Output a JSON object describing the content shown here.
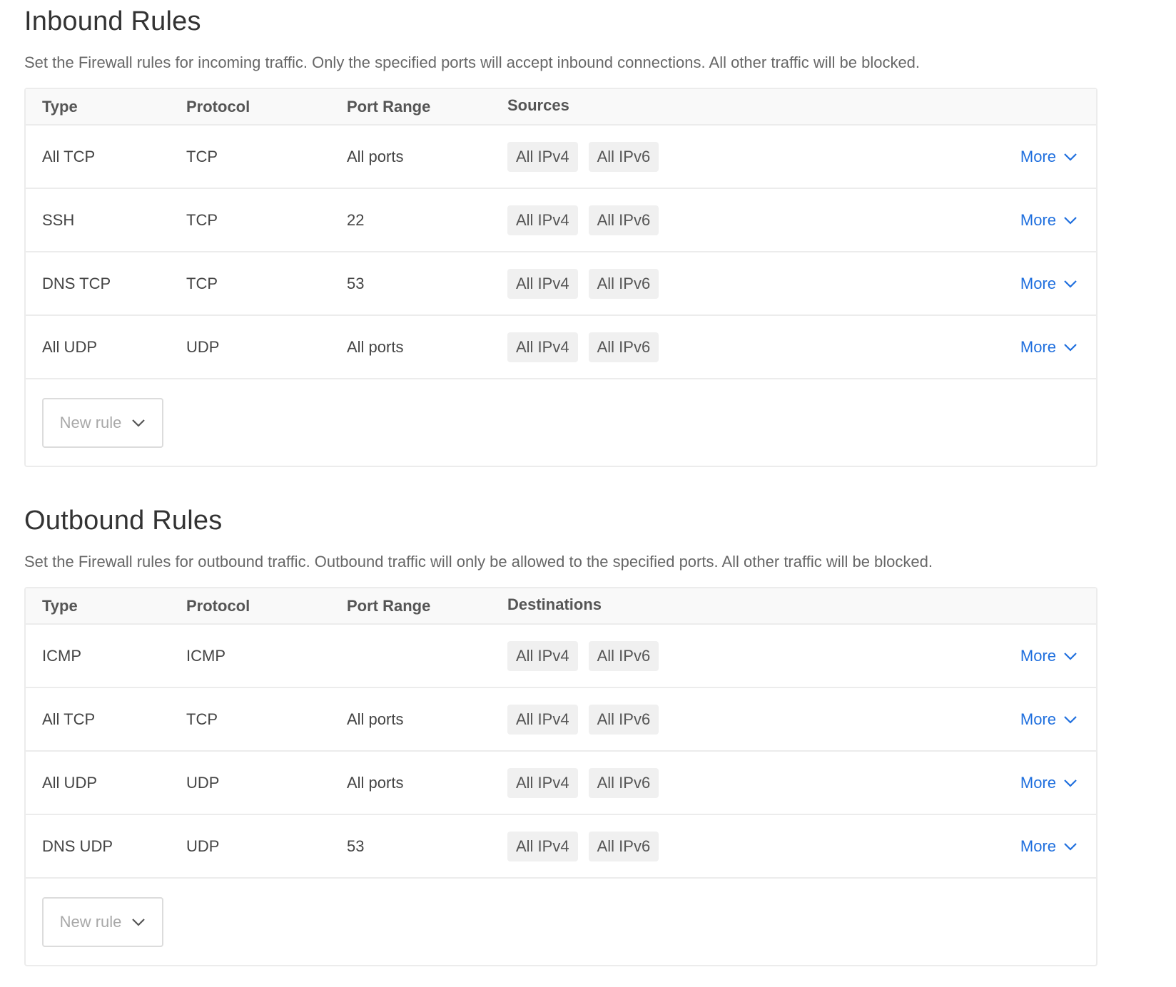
{
  "inbound": {
    "title": "Inbound Rules",
    "description": "Set the Firewall rules for incoming traffic. Only the specified ports will accept inbound connections. All other traffic will be blocked.",
    "headers": {
      "type": "Type",
      "protocol": "Protocol",
      "port_range": "Port Range",
      "targets": "Sources"
    },
    "rows": [
      {
        "type": "All TCP",
        "protocol": "TCP",
        "port_range": "All ports",
        "targets": [
          "All IPv4",
          "All IPv6"
        ],
        "more": "More"
      },
      {
        "type": "SSH",
        "protocol": "TCP",
        "port_range": "22",
        "targets": [
          "All IPv4",
          "All IPv6"
        ],
        "more": "More"
      },
      {
        "type": "DNS TCP",
        "protocol": "TCP",
        "port_range": "53",
        "targets": [
          "All IPv4",
          "All IPv6"
        ],
        "more": "More"
      },
      {
        "type": "All UDP",
        "protocol": "UDP",
        "port_range": "All ports",
        "targets": [
          "All IPv4",
          "All IPv6"
        ],
        "more": "More"
      }
    ],
    "new_rule_label": "New rule"
  },
  "outbound": {
    "title": "Outbound Rules",
    "description": "Set the Firewall rules for outbound traffic. Outbound traffic will only be allowed to the specified ports. All other traffic will be blocked.",
    "headers": {
      "type": "Type",
      "protocol": "Protocol",
      "port_range": "Port Range",
      "targets": "Destinations"
    },
    "rows": [
      {
        "type": "ICMP",
        "protocol": "ICMP",
        "port_range": "",
        "targets": [
          "All IPv4",
          "All IPv6"
        ],
        "more": "More"
      },
      {
        "type": "All TCP",
        "protocol": "TCP",
        "port_range": "All ports",
        "targets": [
          "All IPv4",
          "All IPv6"
        ],
        "more": "More"
      },
      {
        "type": "All UDP",
        "protocol": "UDP",
        "port_range": "All ports",
        "targets": [
          "All IPv4",
          "All IPv6"
        ],
        "more": "More"
      },
      {
        "type": "DNS UDP",
        "protocol": "UDP",
        "port_range": "53",
        "targets": [
          "All IPv4",
          "All IPv6"
        ],
        "more": "More"
      }
    ],
    "new_rule_label": "New rule"
  },
  "icons": {
    "more_chevron": "chevron-down-icon",
    "new_rule_chevron": "chevron-down-icon"
  },
  "colors": {
    "link": "#1f6fde",
    "pill_bg": "#f0f0f0",
    "border": "#ececec",
    "header_bg": "#f9f9f9"
  }
}
